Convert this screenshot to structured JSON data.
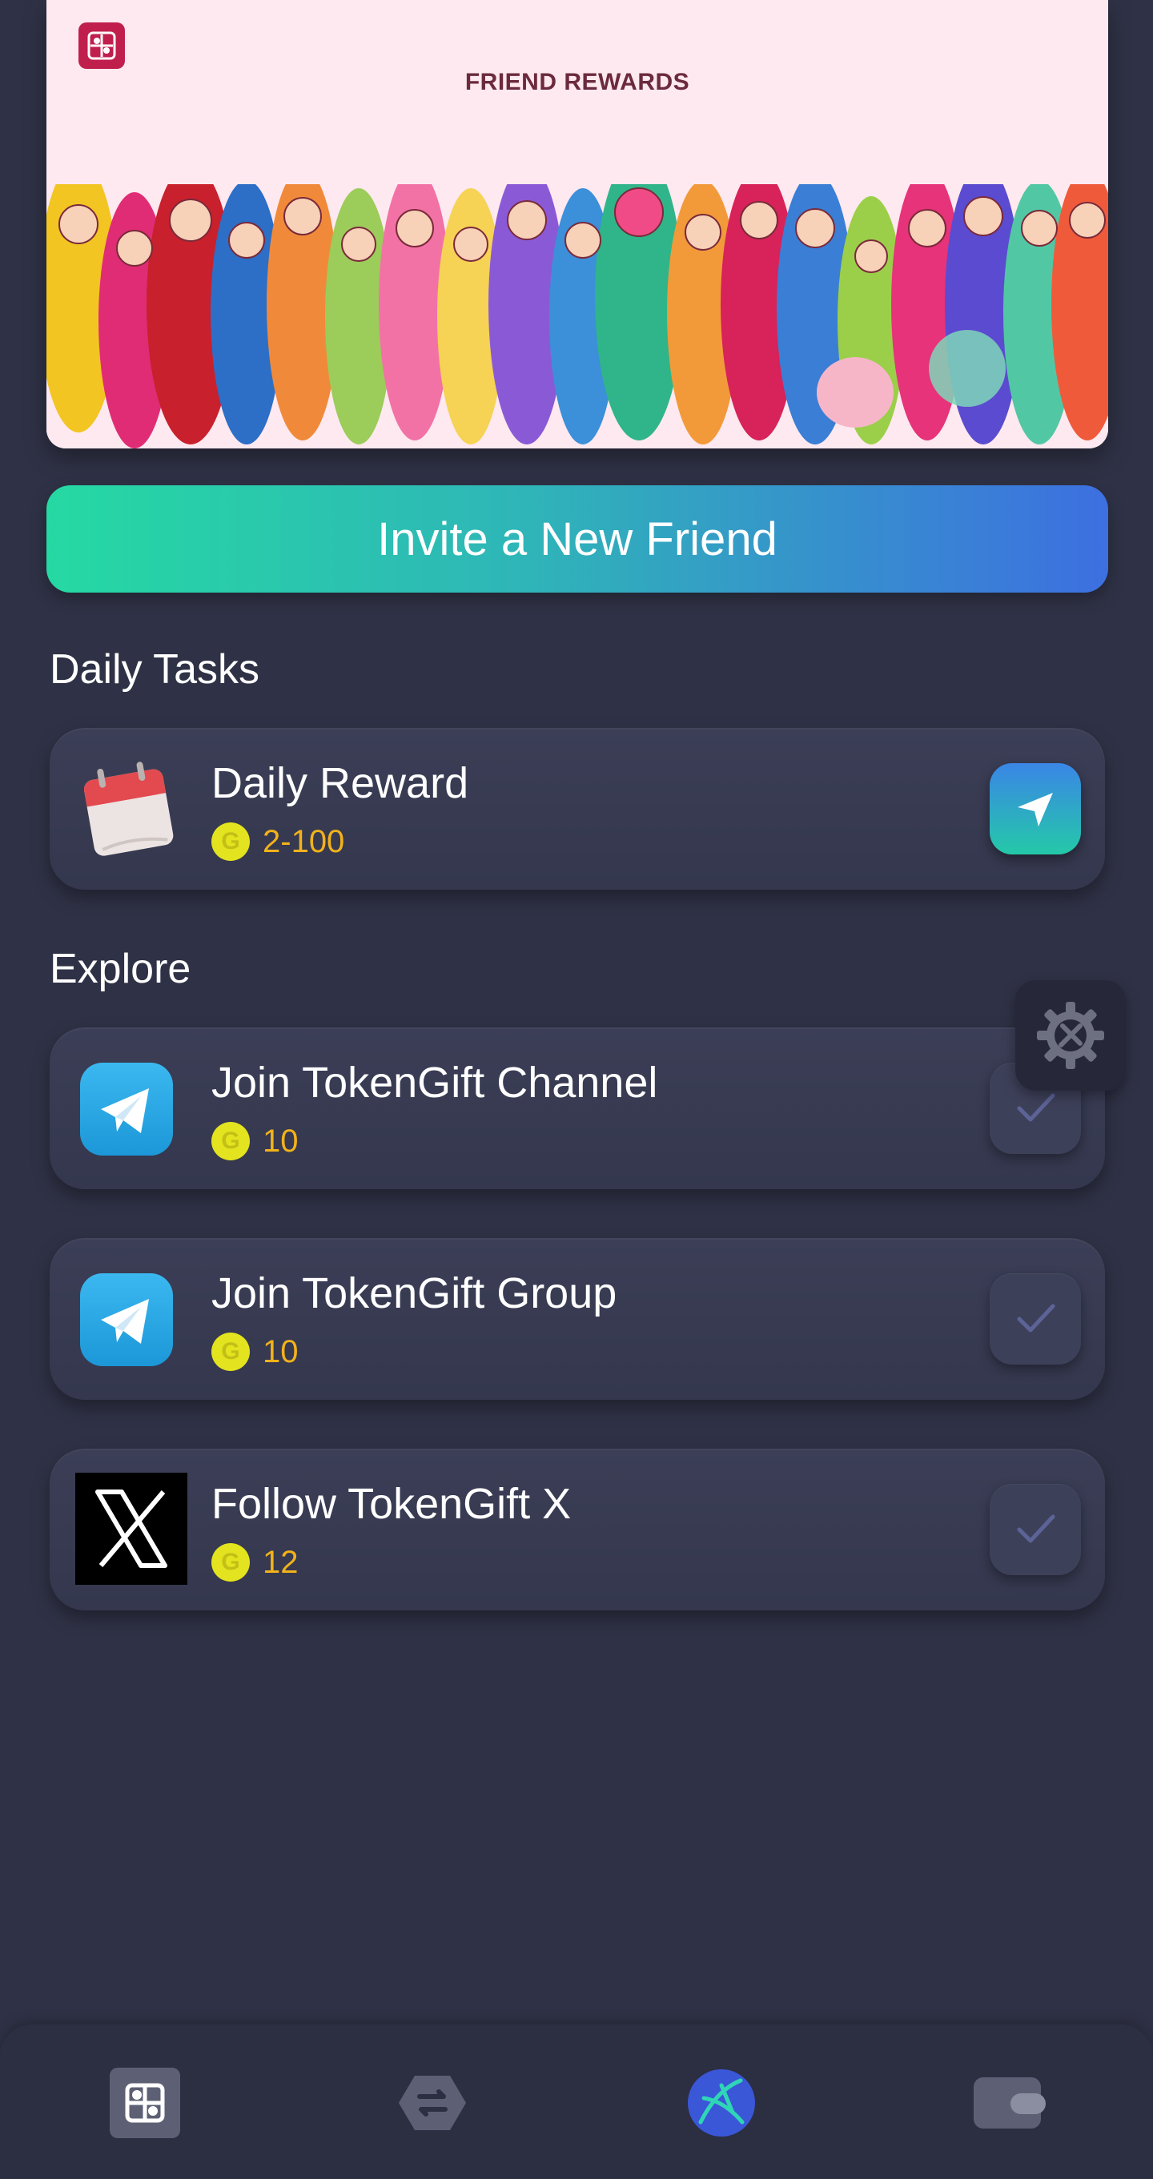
{
  "banner": {
    "title": "FRIEND REWARDS"
  },
  "invite_button": {
    "label": "Invite a New Friend"
  },
  "daily_tasks": {
    "section_title": "Daily Tasks",
    "items": [
      {
        "title": "Daily Reward",
        "reward": "2-100",
        "icon": "calendar-icon",
        "action": "go"
      }
    ]
  },
  "explore": {
    "section_title": "Explore",
    "items": [
      {
        "title": "Join TokenGift Channel",
        "reward": "10",
        "icon": "telegram-icon",
        "action": "check"
      },
      {
        "title": "Join TokenGift Group",
        "reward": "10",
        "icon": "telegram-icon",
        "action": "check"
      },
      {
        "title": "Follow TokenGift X",
        "reward": "12",
        "icon": "x-logo-icon",
        "action": "check"
      }
    ]
  },
  "coin_symbol": "G",
  "colors": {
    "background": "#2f3246",
    "accent_gradient_start": "#25d9a3",
    "accent_gradient_end": "#3d6fe0",
    "reward_text": "#f2b21a",
    "coin": "#e4e31f",
    "banner_bg": "#fde9ef"
  },
  "bottom_nav": {
    "items": [
      {
        "icon": "home-logo-icon",
        "active": false
      },
      {
        "icon": "swap-icon",
        "active": false
      },
      {
        "icon": "explore-icon",
        "active": true
      },
      {
        "icon": "wallet-icon",
        "active": false
      }
    ]
  }
}
